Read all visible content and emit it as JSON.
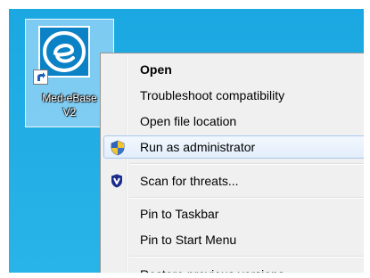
{
  "desktop": {
    "shortcut": {
      "label": "Med-eBase\nV2",
      "icon": "med-ebase-app-icon",
      "overlay_icon": "shortcut-arrow-icon"
    }
  },
  "context_menu": {
    "items": [
      {
        "label": "Open",
        "bold": true
      },
      {
        "label": "Troubleshoot compatibility"
      },
      {
        "label": "Open file location"
      },
      {
        "label": "Run as administrator",
        "icon": "uac-shield-icon",
        "highlighted": true
      },
      {
        "label": "Scan for threats...",
        "icon": "antivirus-shield-icon"
      },
      {
        "label": "Pin to Taskbar"
      },
      {
        "label": "Pin to Start Menu"
      },
      {
        "label": "Restore previous versions"
      }
    ]
  },
  "colors": {
    "desktop_background": "#21aee4",
    "menu_background": "#f0f0f0",
    "menu_highlight_border": "#a8c8ec",
    "app_icon_blue": "#0b7dc0"
  }
}
